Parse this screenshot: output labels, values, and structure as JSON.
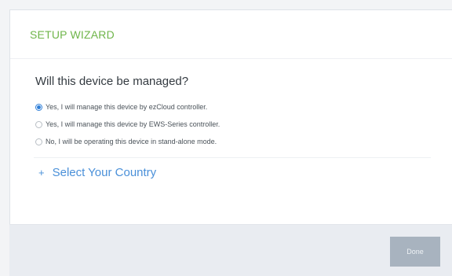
{
  "wizard": {
    "title": "SETUP WIZARD"
  },
  "question": "Will this device be managed?",
  "options": [
    {
      "label": "Yes, I will manage this device by ezCloud controller.",
      "selected": true
    },
    {
      "label": "Yes, I will manage this device by EWS-Series controller.",
      "selected": false
    },
    {
      "label": "No, I will be operating this device in stand-alone mode.",
      "selected": false
    }
  ],
  "country": {
    "icon": "plus-icon",
    "label": "Select Your Country"
  },
  "footer": {
    "done_label": "Done"
  },
  "colors": {
    "accent_green": "#6fb54a",
    "link_blue": "#4a90d9",
    "radio_blue": "#2f7fd8",
    "button_disabled": "#a8b3bf"
  }
}
